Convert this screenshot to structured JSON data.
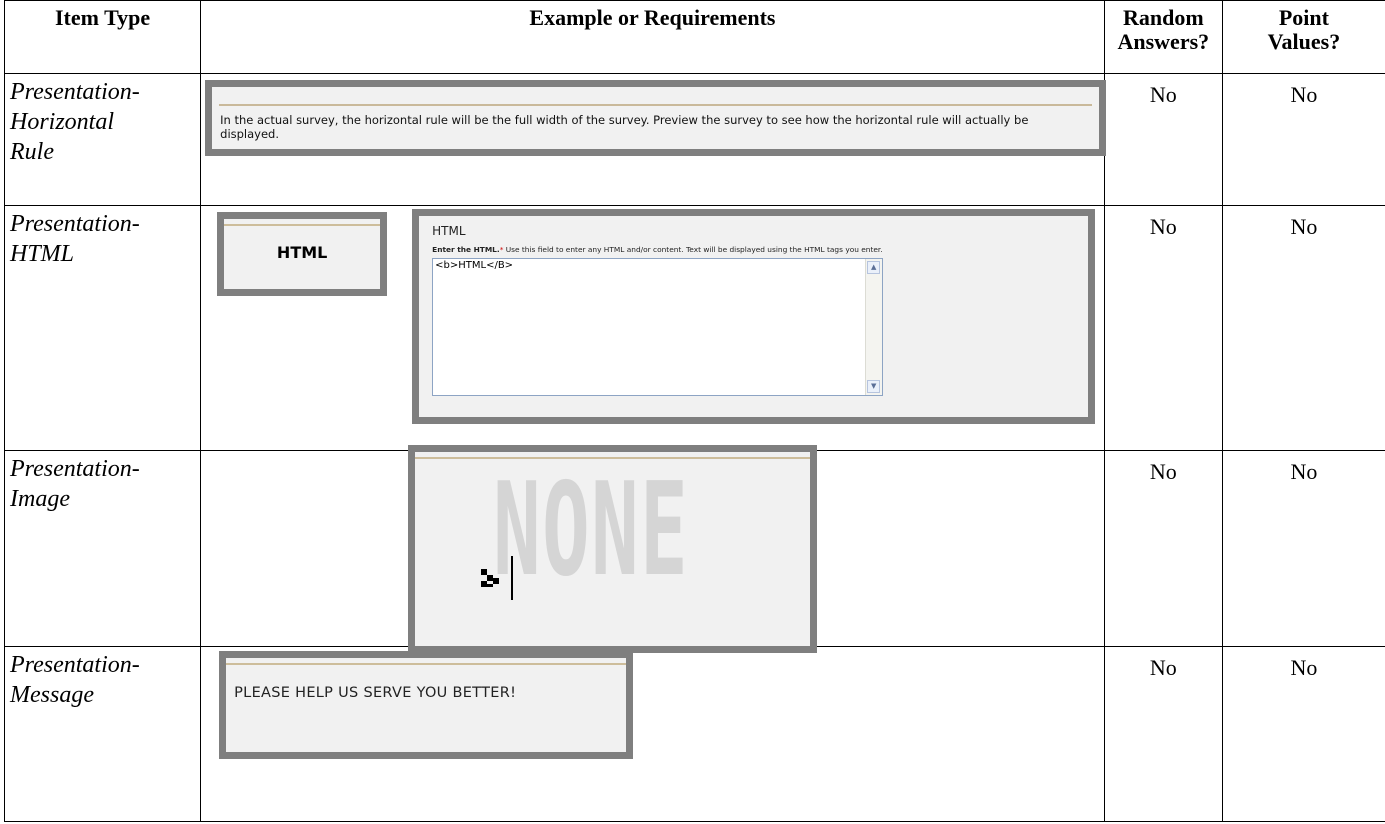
{
  "headers": {
    "item_type": "Item Type",
    "example": "Example or Requirements",
    "random_line1": "Random",
    "random_line2": "Answers?",
    "point_line1": "Point",
    "point_line2": "Values?"
  },
  "rows": [
    {
      "type_line1": "Presentation-",
      "type_line2": "Horizontal",
      "type_line3": "Rule",
      "random": "No",
      "points": "No",
      "example_text": "In the actual survey, the horizontal rule will be the full width of the survey. Preview the survey to see how the horizontal rule will actually be displayed."
    },
    {
      "type_line1": "Presentation-",
      "type_line2": "HTML",
      "random": "No",
      "points": "No",
      "button_label": "HTML",
      "form_title": "HTML",
      "form_desc_bold": "Enter the HTML.",
      "form_desc_req": "*",
      "form_desc_rest": " Use this field to enter any HTML and/or content. Text will be displayed using the HTML tags you enter.",
      "textarea_value": "<b>HTML</B>"
    },
    {
      "type_line1": "Presentation-",
      "type_line2": "Image",
      "random": "No",
      "points": "No",
      "image_text": "NONE",
      "image_icon": "broken-image-icon"
    },
    {
      "type_line1": "Presentation-",
      "type_line2": "Message",
      "random": "No",
      "points": "No",
      "message_text": "PLEASE HELP US SERVE YOU BETTER!"
    }
  ],
  "colors": {
    "frame": "#7f7f7f",
    "panel": "#f1f1f1",
    "required": "#cc0000"
  }
}
